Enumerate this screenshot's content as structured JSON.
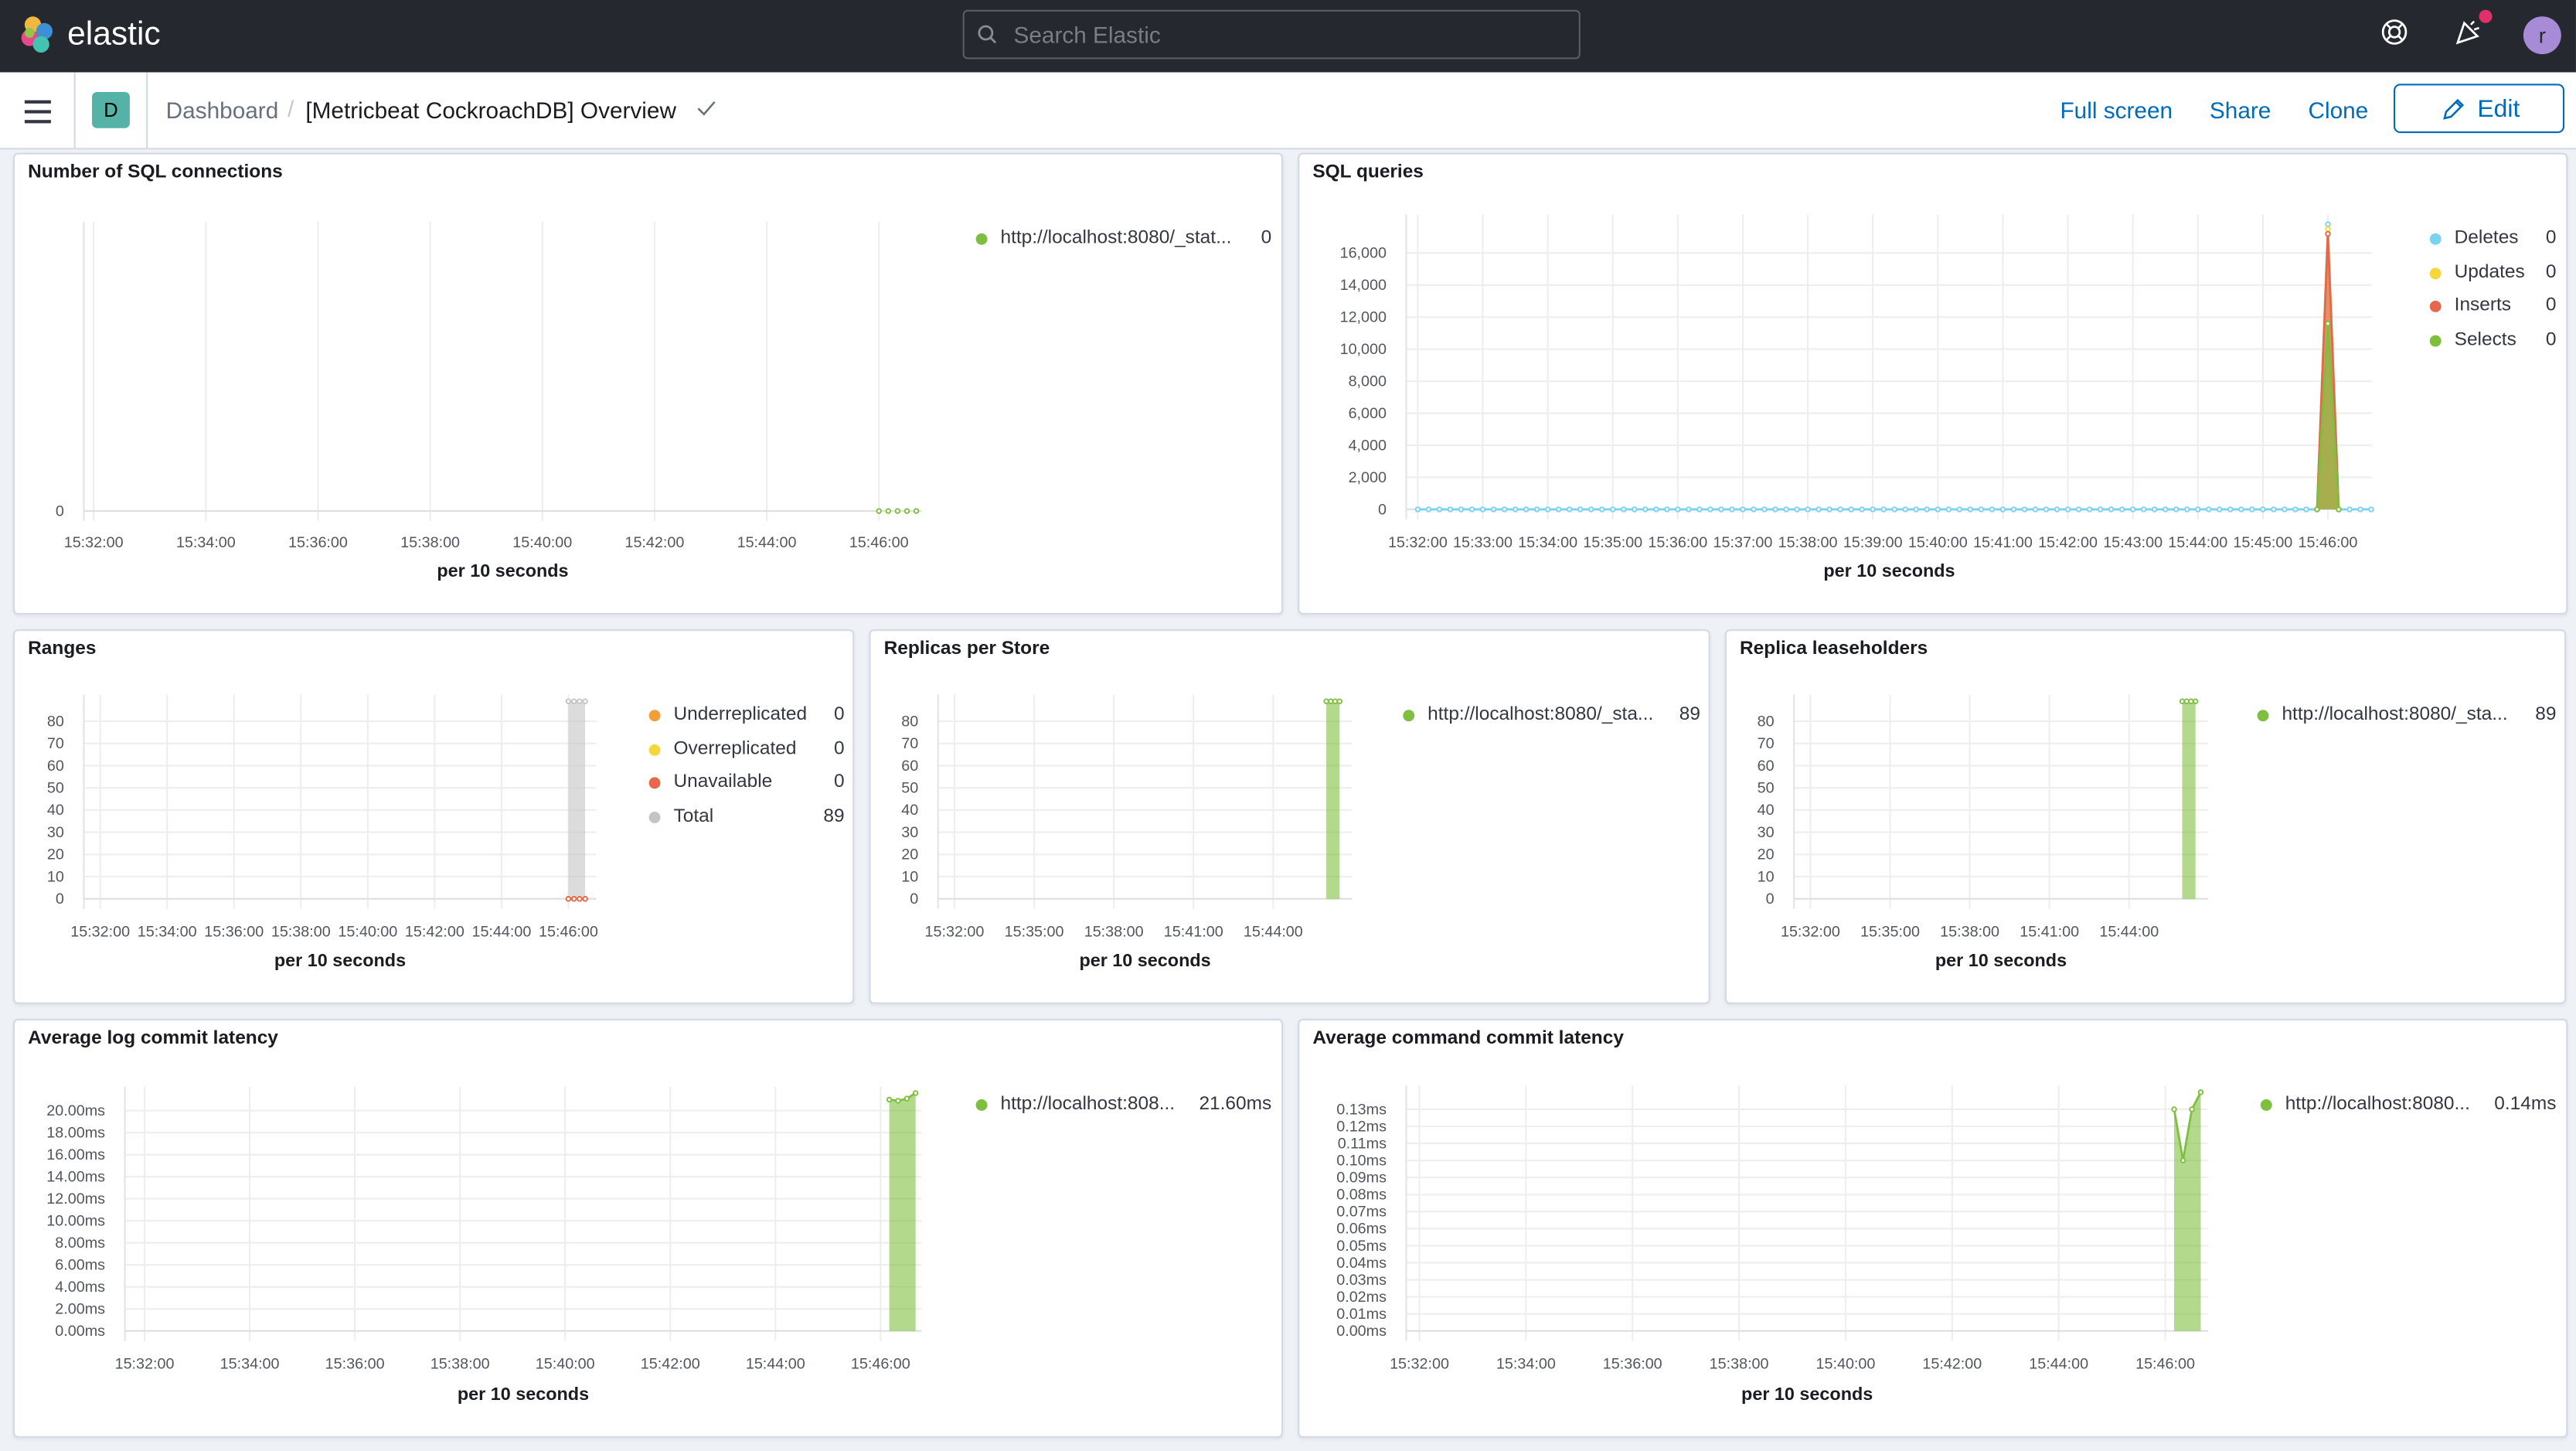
{
  "header": {
    "brand": "elastic",
    "search_placeholder": "Search Elastic",
    "avatar_initial": "r",
    "icons": [
      "elastic-logo-icon",
      "search-icon",
      "help-icon",
      "newsfeed-icon",
      "notification-dot"
    ]
  },
  "nav": {
    "space_badge": "D",
    "breadcrumb_root": "Dashboard",
    "breadcrumb_sep": "/",
    "breadcrumb_current": "[Metricbeat CockroachDB] Overview",
    "full_screen": "Full screen",
    "share": "Share",
    "clone": "Clone",
    "edit": "Edit"
  },
  "colors": {
    "accent": "#006bb8",
    "green": "#7fbf3f",
    "blue": "#79d2f2",
    "yellow": "#f5d63d",
    "red": "#e7664c",
    "orange": "#f19f38",
    "gray": "#c4c4c4"
  },
  "chart_data": [
    {
      "id": "p1",
      "type": "line",
      "title": "Number of SQL connections",
      "xlabel": "per 10 seconds",
      "xticks": [
        "15:32:00",
        "15:34:00",
        "15:36:00",
        "15:38:00",
        "15:40:00",
        "15:42:00",
        "15:44:00",
        "15:46:00"
      ],
      "yticks": [
        {
          "v": 0,
          "label": "0"
        }
      ],
      "ylim": [
        0,
        1
      ],
      "grid": true,
      "legend": "top-right",
      "series": [
        {
          "name": "http://localhost:8080/_stat...",
          "legend_value": "0",
          "color": "#7fbf3f",
          "style": "dots",
          "start": "15:46:00",
          "step_s": 10,
          "values": [
            0,
            0,
            0,
            0,
            0
          ]
        }
      ]
    },
    {
      "id": "p2",
      "type": "area",
      "title": "SQL queries",
      "xlabel": "per 10 seconds",
      "xticks": [
        "15:32:00",
        "15:33:00",
        "15:34:00",
        "15:35:00",
        "15:36:00",
        "15:37:00",
        "15:38:00",
        "15:39:00",
        "15:40:00",
        "15:41:00",
        "15:42:00",
        "15:43:00",
        "15:44:00",
        "15:45:00",
        "15:46:00"
      ],
      "yticks": [
        {
          "v": 0,
          "label": "0"
        },
        {
          "v": 2000,
          "label": "2,000"
        },
        {
          "v": 4000,
          "label": "4,000"
        },
        {
          "v": 6000,
          "label": "6,000"
        },
        {
          "v": 8000,
          "label": "8,000"
        },
        {
          "v": 10000,
          "label": "10,000"
        },
        {
          "v": 12000,
          "label": "12,000"
        },
        {
          "v": 14000,
          "label": "14,000"
        },
        {
          "v": 16000,
          "label": "16,000"
        }
      ],
      "ylim": [
        0,
        18000
      ],
      "grid": true,
      "legend": "top-right",
      "series": [
        {
          "name": "Deletes",
          "legend_value": "0",
          "color": "#79d2f2",
          "style": "area",
          "start": "15:32:00",
          "step_s": 10,
          "values": [
            0,
            0,
            0,
            0,
            0,
            0,
            0,
            0,
            0,
            0,
            0,
            0,
            0,
            0,
            0,
            0,
            0,
            0,
            0,
            0,
            0,
            0,
            0,
            0,
            0,
            0,
            0,
            0,
            0,
            0,
            0,
            0,
            0,
            0,
            0,
            0,
            0,
            0,
            0,
            0,
            0,
            0,
            0,
            0,
            0,
            0,
            0,
            0,
            0,
            0,
            0,
            0,
            0,
            0,
            0,
            0,
            0,
            0,
            0,
            0,
            0,
            0,
            0,
            0,
            0,
            0,
            0,
            0,
            0,
            0,
            0,
            0,
            0,
            0,
            0,
            0,
            0,
            0,
            0,
            0,
            0,
            0,
            0,
            0,
            17800,
            0,
            0,
            0,
            0
          ]
        },
        {
          "name": "Updates",
          "legend_value": "0",
          "color": "#f5d63d",
          "style": "area",
          "start": "15:45:50",
          "step_s": 10,
          "values": [
            0,
            17500,
            0
          ]
        },
        {
          "name": "Inserts",
          "legend_value": "0",
          "color": "#e7664c",
          "style": "area",
          "start": "15:45:50",
          "step_s": 10,
          "values": [
            0,
            17200,
            0
          ]
        },
        {
          "name": "Selects",
          "legend_value": "0",
          "color": "#7fbf3f",
          "style": "area",
          "start": "15:45:50",
          "step_s": 10,
          "values": [
            0,
            11600,
            0
          ]
        }
      ]
    },
    {
      "id": "p3",
      "type": "area",
      "title": "Ranges",
      "xlabel": "per 10 seconds",
      "xticks": [
        "15:32:00",
        "15:34:00",
        "15:36:00",
        "15:38:00",
        "15:40:00",
        "15:42:00",
        "15:44:00",
        "15:46:00"
      ],
      "yticks": [
        {
          "v": 0,
          "label": "0"
        },
        {
          "v": 10,
          "label": "10"
        },
        {
          "v": 20,
          "label": "20"
        },
        {
          "v": 30,
          "label": "30"
        },
        {
          "v": 40,
          "label": "40"
        },
        {
          "v": 50,
          "label": "50"
        },
        {
          "v": 60,
          "label": "60"
        },
        {
          "v": 70,
          "label": "70"
        },
        {
          "v": 80,
          "label": "80"
        }
      ],
      "ylim": [
        0,
        89
      ],
      "grid": true,
      "legend": "top-right",
      "series": [
        {
          "name": "Underreplicated",
          "legend_value": "0",
          "color": "#f19f38",
          "style": "dots",
          "start": "15:46:00",
          "step_s": 10,
          "values": [
            0,
            0,
            0,
            0
          ]
        },
        {
          "name": "Overreplicated",
          "legend_value": "0",
          "color": "#f5d63d",
          "style": "dots",
          "start": "15:46:00",
          "step_s": 10,
          "values": [
            0,
            0,
            0,
            0
          ]
        },
        {
          "name": "Unavailable",
          "legend_value": "0",
          "color": "#e7664c",
          "style": "dots",
          "start": "15:46:00",
          "step_s": 10,
          "values": [
            0,
            0,
            0,
            0
          ]
        },
        {
          "name": "Total",
          "legend_value": "89",
          "color": "#c4c4c4",
          "style": "area",
          "start": "15:46:00",
          "step_s": 10,
          "values": [
            89,
            89,
            89,
            89
          ]
        }
      ]
    },
    {
      "id": "p4",
      "type": "area",
      "title": "Replicas per Store",
      "xlabel": "per 10 seconds",
      "xticks": [
        "15:32:00",
        "15:35:00",
        "15:38:00",
        "15:41:00",
        "15:44:00"
      ],
      "yticks": [
        {
          "v": 0,
          "label": "0"
        },
        {
          "v": 10,
          "label": "10"
        },
        {
          "v": 20,
          "label": "20"
        },
        {
          "v": 30,
          "label": "30"
        },
        {
          "v": 40,
          "label": "40"
        },
        {
          "v": 50,
          "label": "50"
        },
        {
          "v": 60,
          "label": "60"
        },
        {
          "v": 70,
          "label": "70"
        },
        {
          "v": 80,
          "label": "80"
        }
      ],
      "ylim": [
        0,
        89
      ],
      "grid": true,
      "legend": "top-right",
      "series": [
        {
          "name": "http://localhost:8080/_sta...",
          "legend_value": "89",
          "color": "#7fbf3f",
          "style": "area",
          "start": "15:46:00",
          "step_s": 10,
          "values": [
            89,
            89,
            89,
            89
          ]
        }
      ]
    },
    {
      "id": "p5",
      "type": "area",
      "title": "Replica leaseholders",
      "xlabel": "per 10 seconds",
      "xticks": [
        "15:32:00",
        "15:35:00",
        "15:38:00",
        "15:41:00",
        "15:44:00"
      ],
      "yticks": [
        {
          "v": 0,
          "label": "0"
        },
        {
          "v": 10,
          "label": "10"
        },
        {
          "v": 20,
          "label": "20"
        },
        {
          "v": 30,
          "label": "30"
        },
        {
          "v": 40,
          "label": "40"
        },
        {
          "v": 50,
          "label": "50"
        },
        {
          "v": 60,
          "label": "60"
        },
        {
          "v": 70,
          "label": "70"
        },
        {
          "v": 80,
          "label": "80"
        }
      ],
      "ylim": [
        0,
        89
      ],
      "grid": true,
      "legend": "top-right",
      "series": [
        {
          "name": "http://localhost:8080/_sta...",
          "legend_value": "89",
          "color": "#7fbf3f",
          "style": "area",
          "start": "15:46:00",
          "step_s": 10,
          "values": [
            89,
            89,
            89,
            89
          ]
        }
      ]
    },
    {
      "id": "p6",
      "type": "area",
      "title": "Average log commit latency",
      "xlabel": "per 10 seconds",
      "xticks": [
        "15:32:00",
        "15:34:00",
        "15:36:00",
        "15:38:00",
        "15:40:00",
        "15:42:00",
        "15:44:00",
        "15:46:00"
      ],
      "yticks": [
        {
          "v": 0,
          "label": "0.00ms"
        },
        {
          "v": 2,
          "label": "2.00ms"
        },
        {
          "v": 4,
          "label": "4.00ms"
        },
        {
          "v": 6,
          "label": "6.00ms"
        },
        {
          "v": 8,
          "label": "8.00ms"
        },
        {
          "v": 10,
          "label": "10.00ms"
        },
        {
          "v": 12,
          "label": "12.00ms"
        },
        {
          "v": 14,
          "label": "14.00ms"
        },
        {
          "v": 16,
          "label": "16.00ms"
        },
        {
          "v": 18,
          "label": "18.00ms"
        },
        {
          "v": 20,
          "label": "20.00ms"
        }
      ],
      "ylim": [
        0,
        21.6
      ],
      "grid": true,
      "legend": "top-right",
      "series": [
        {
          "name": "http://localhost:808...",
          "legend_value": "21.60ms",
          "color": "#7fbf3f",
          "style": "area",
          "start": "15:46:10",
          "step_s": 10,
          "values": [
            21.0,
            20.9,
            21.1,
            21.6
          ]
        }
      ]
    },
    {
      "id": "p7",
      "type": "area",
      "title": "Average command commit latency",
      "xlabel": "per 10 seconds",
      "xticks": [
        "15:32:00",
        "15:34:00",
        "15:36:00",
        "15:38:00",
        "15:40:00",
        "15:42:00",
        "15:44:00",
        "15:46:00"
      ],
      "yticks": [
        {
          "v": 0,
          "label": "0.00ms"
        },
        {
          "v": 0.01,
          "label": "0.01ms"
        },
        {
          "v": 0.02,
          "label": "0.02ms"
        },
        {
          "v": 0.03,
          "label": "0.03ms"
        },
        {
          "v": 0.04,
          "label": "0.04ms"
        },
        {
          "v": 0.05,
          "label": "0.05ms"
        },
        {
          "v": 0.06,
          "label": "0.06ms"
        },
        {
          "v": 0.07,
          "label": "0.07ms"
        },
        {
          "v": 0.08,
          "label": "0.08ms"
        },
        {
          "v": 0.09,
          "label": "0.09ms"
        },
        {
          "v": 0.1,
          "label": "0.10ms"
        },
        {
          "v": 0.11,
          "label": "0.11ms"
        },
        {
          "v": 0.12,
          "label": "0.12ms"
        },
        {
          "v": 0.13,
          "label": "0.13ms"
        }
      ],
      "ylim": [
        0,
        0.14
      ],
      "grid": true,
      "legend": "top-right",
      "series": [
        {
          "name": "http://localhost:8080...",
          "legend_value": "0.14ms",
          "color": "#7fbf3f",
          "style": "area",
          "start": "15:46:10",
          "step_s": 10,
          "values": [
            0.13,
            0.1,
            0.13,
            0.14
          ]
        }
      ]
    }
  ]
}
